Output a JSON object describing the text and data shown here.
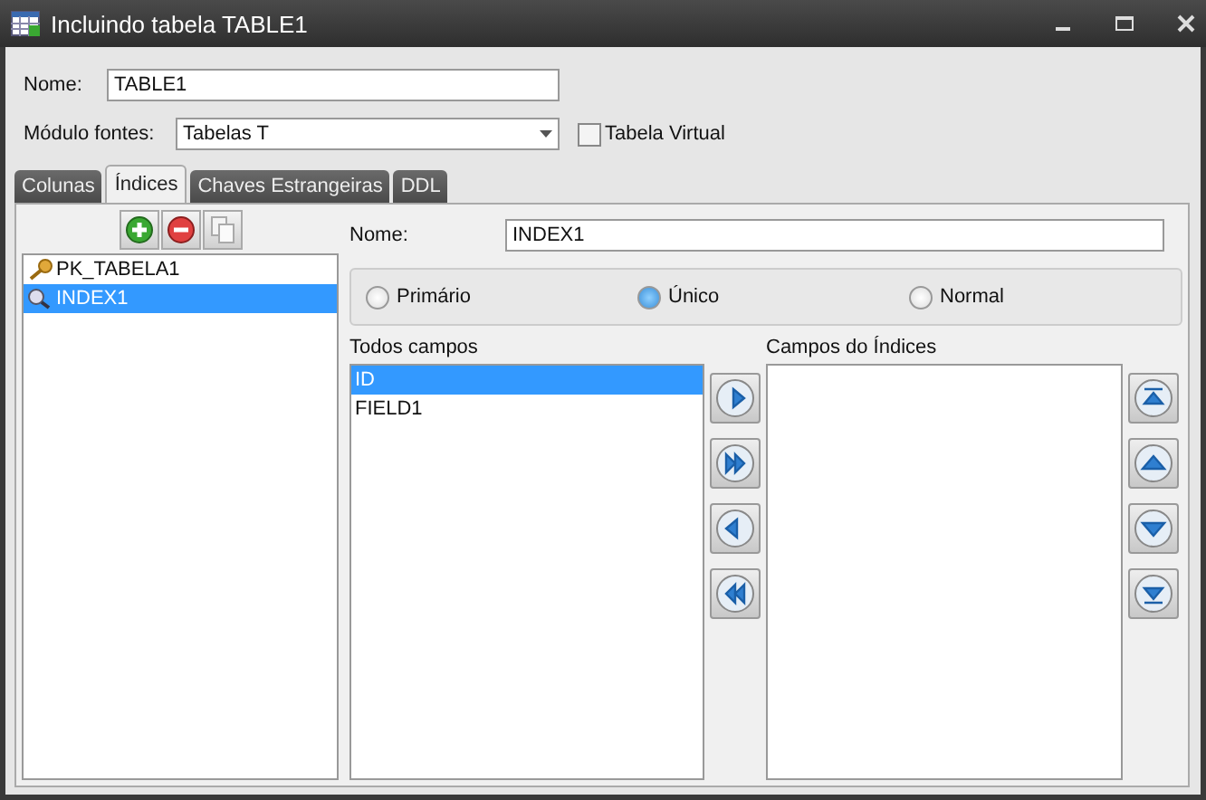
{
  "window": {
    "title": "Incluindo tabela TABLE1"
  },
  "name_field": {
    "label": "Nome:",
    "value": "TABLE1"
  },
  "module_field": {
    "label": "Módulo fontes:",
    "value": "Tabelas T"
  },
  "virtual_checkbox": {
    "label": "Tabela Virtual",
    "checked": false
  },
  "tabs": [
    {
      "label": "Colunas",
      "selected": false
    },
    {
      "label": "Índices",
      "selected": true
    },
    {
      "label": "Chaves Estrangeiras",
      "selected": false
    },
    {
      "label": "DDL",
      "selected": false
    }
  ],
  "toolbar": [
    {
      "kind": "add"
    },
    {
      "kind": "remove"
    },
    {
      "kind": "copy"
    }
  ],
  "indexes": [
    {
      "label": "PK_TABELA1",
      "kind": "primary",
      "selected": false
    },
    {
      "label": "INDEX1",
      "kind": "index",
      "selected": true
    }
  ],
  "index_name": {
    "label": "Nome:",
    "value": "INDEX1"
  },
  "index_types": [
    {
      "label": "Primário",
      "selected": false
    },
    {
      "label": "Único",
      "selected": true
    },
    {
      "label": "Normal",
      "selected": false
    }
  ],
  "all_fields": {
    "label": "Todos campos",
    "items": [
      {
        "label": "ID",
        "selected": true
      },
      {
        "label": "FIELD1",
        "selected": false
      }
    ]
  },
  "index_fields": {
    "label": "Campos do Índices"
  },
  "move_buttons": [
    {
      "kind": "right"
    },
    {
      "kind": "all-right"
    },
    {
      "kind": "left"
    },
    {
      "kind": "all-left"
    }
  ],
  "order_buttons": [
    {
      "kind": "top"
    },
    {
      "kind": "up"
    },
    {
      "kind": "down"
    },
    {
      "kind": "bottom"
    }
  ]
}
